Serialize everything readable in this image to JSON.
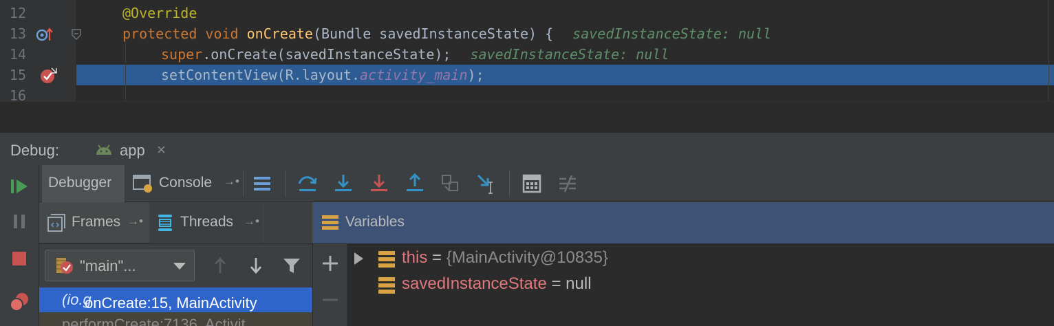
{
  "editor": {
    "lines": [
      {
        "num": "12",
        "text": "@Override"
      },
      {
        "num": "13",
        "kw1": "protected",
        "kw2": "void",
        "fn": "onCreate",
        "rest": "(Bundle savedInstanceState) {",
        "hint": "savedInstanceState: null"
      },
      {
        "num": "14",
        "kw": "super",
        "rest": ".onCreate(savedInstanceState);",
        "hint": "savedInstanceState: null"
      },
      {
        "num": "15",
        "pre": "setContentView(R.layout.",
        "field": "activity_main",
        "post": ");"
      },
      {
        "num": "16"
      }
    ],
    "colors": {
      "keyword": "#cc7832",
      "annotation": "#bbb529",
      "function": "#ffc66d",
      "hint": "#5f8f6a",
      "current_line": "#2d5b93"
    }
  },
  "debug_header": {
    "label": "Debug:",
    "tab": {
      "label": "app",
      "close": "×",
      "icon": "android-icon"
    }
  },
  "toolbar": {
    "debugger_tab": "Debugger",
    "console_tab": "Console",
    "console_pin": "→•",
    "icons": [
      "resume-icon",
      "pause-icon",
      "stop-icon",
      "view-breakpoints-icon",
      "show-execution-point-icon",
      "step-over-icon",
      "step-into-icon",
      "force-step-into-icon",
      "step-out-icon",
      "drop-frame-icon",
      "run-to-cursor-icon",
      "evaluate-expression-icon",
      "trace-icon"
    ]
  },
  "panels": {
    "frames_label": "Frames",
    "threads_label": "Threads",
    "variables_label": "Variables",
    "pin": "→•"
  },
  "frames": {
    "thread_select": "\"main\"...",
    "rows": [
      {
        "text": "onCreate:15, MainActivity ",
        "pkg": "(io.g"
      },
      {
        "text": "performCreate:7136, Activit"
      }
    ]
  },
  "variables": [
    {
      "name": "this",
      "eq": " = ",
      "value": "{MainActivity@10835}",
      "expandable": true
    },
    {
      "name": "savedInstanceState",
      "eq": " = ",
      "value": "null",
      "expandable": false
    }
  ]
}
